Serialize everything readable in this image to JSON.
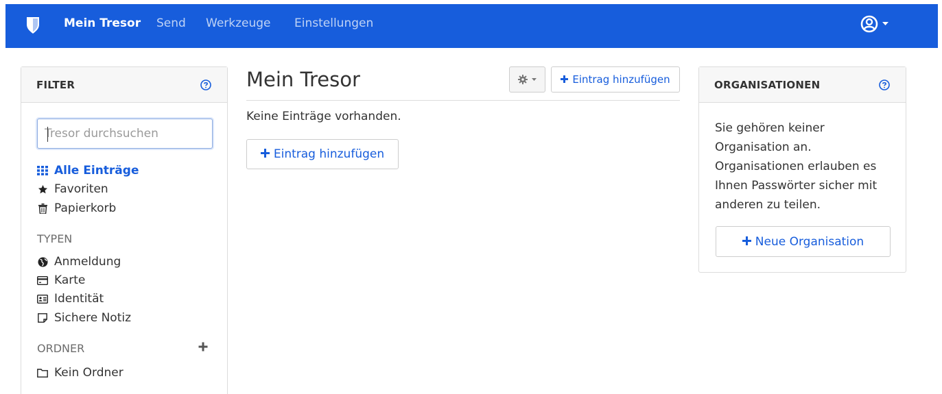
{
  "nav": {
    "links": [
      "Mein Tresor",
      "Send",
      "Werkzeuge",
      "Einstellungen"
    ],
    "brand_color": "#175ddc"
  },
  "filter": {
    "title": "FILTER",
    "search_placeholder": "Tresor durchsuchen",
    "items": [
      "Alle Einträge",
      "Favoriten",
      "Papierkorb"
    ],
    "types_label": "TYPEN",
    "types": [
      "Anmeldung",
      "Karte",
      "Identität",
      "Sichere Notiz"
    ],
    "folders_label": "ORDNER",
    "folders": [
      "Kein Ordner"
    ]
  },
  "main": {
    "title": "Mein Tresor",
    "add_item_top": "Eintrag hinzufügen",
    "empty_text": "Keine Einträge vorhanden.",
    "add_item_empty": "Eintrag hinzufügen"
  },
  "organizations": {
    "title": "ORGANISATIONEN",
    "text": "Sie gehören keiner Organisation an. Organisationen erlauben es Ihnen Passwörter sicher mit anderen zu teilen.",
    "new_button": "Neue Organisation"
  }
}
